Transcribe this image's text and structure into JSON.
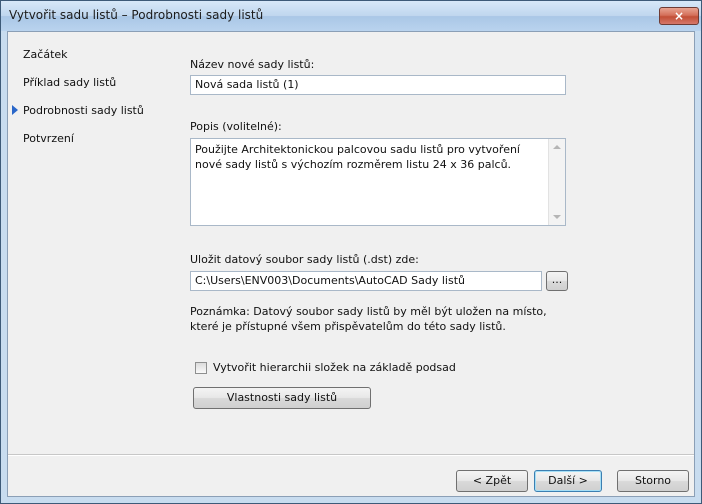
{
  "window": {
    "title": "Vytvořit sadu listů – Podrobnosti sady listů",
    "close_label": "×"
  },
  "steps": [
    {
      "label": "Začátek"
    },
    {
      "label": "Příklad sady listů"
    },
    {
      "label": "Podrobnosti sady listů",
      "active": true
    },
    {
      "label": "Potvrzení"
    }
  ],
  "form": {
    "name_label": "Název nové sady listů:",
    "name_value": "Nová sada listů (1)",
    "description_label": "Popis (volitelné):",
    "description_value": "Použijte Architektonickou palcovou sadu listů pro vytvoření nové sady listů s výchozím rozměrem listu 24 x 36 palců.",
    "dst_label": "Uložit datový soubor sady listů (.dst) zde:",
    "dst_path": "C:\\Users\\ENV003\\Documents\\AutoCAD Sady listů",
    "browse_label": "...",
    "note": "Poznámka: Datový soubor sady listů by měl být uložen na místo, které je přístupné všem přispěvatelům do této sady listů.",
    "hierarchy_checkbox_label": "Vytvořit hierarchii složek na základě podsad",
    "hierarchy_checked": false,
    "properties_button": "Vlastnosti sady listů"
  },
  "footer": {
    "back": "< Zpět",
    "next": "Další >",
    "cancel": "Storno"
  }
}
